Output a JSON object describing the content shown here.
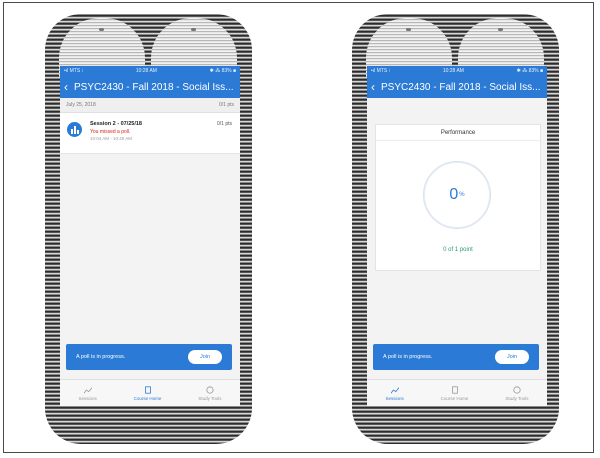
{
  "left_phone": {
    "status": {
      "carrier": "•ıl MTS ⁝",
      "time": "10:28 AM",
      "battery": "✱ ⁂ 83% ■"
    },
    "nav": {
      "back": "‹",
      "title": "PSYC2430 - Fall 2018 - Social Iss..."
    },
    "date_row": {
      "date": "July 25, 2018",
      "score": "0/1 pts"
    },
    "session": {
      "name": "Session 2 - 07/25/18",
      "pts": "0/1 pts",
      "missed": "You missed a poll.",
      "time": "10:04 AM - 10:40 AM"
    },
    "poll_banner": {
      "message": "A poll is in progress.",
      "join": "Join"
    },
    "tabs": [
      {
        "label": "Sessions",
        "icon": "trend-icon"
      },
      {
        "label": "Course Home",
        "icon": "book-icon"
      },
      {
        "label": "Study Tools",
        "icon": "study-icon"
      }
    ],
    "accent": "#2b7ad6"
  },
  "right_phone": {
    "status": {
      "carrier": "•ıl MTS ⁝",
      "time": "10:28 AM",
      "battery": "✱ ⁂ 83% ■"
    },
    "nav": {
      "back": "‹",
      "title": "PSYC2430 - Fall 2018 - Social Iss..."
    },
    "performance": {
      "title": "Performance",
      "percent": "0",
      "unit": "%",
      "points": "0 of 1 point"
    },
    "poll_banner": {
      "message": "A poll is in progress.",
      "join": "Join"
    },
    "tabs": [
      {
        "label": "Sessions",
        "icon": "trend-icon"
      },
      {
        "label": "Course Home",
        "icon": "book-icon"
      },
      {
        "label": "Study Tools",
        "icon": "study-icon"
      }
    ],
    "accent": "#2b7ad6"
  }
}
